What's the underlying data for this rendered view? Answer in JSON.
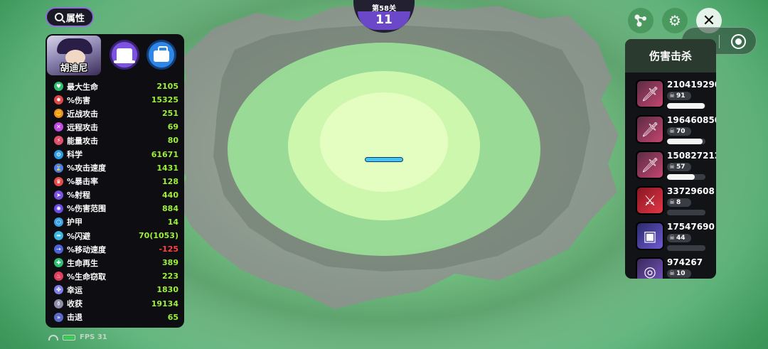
{
  "header": {
    "attr_label": "属性"
  },
  "hero": {
    "name": "胡迪尼"
  },
  "stats": [
    {
      "label": "最大生命",
      "value": "2105",
      "color": "#2fbf71"
    },
    {
      "label": "%伤害",
      "value": "15325",
      "color": "#e04848"
    },
    {
      "label": "近战攻击",
      "value": "251",
      "color": "#f08a2a"
    },
    {
      "label": "远程攻击",
      "value": "69",
      "color": "#c04be0"
    },
    {
      "label": "能量攻击",
      "value": "80",
      "color": "#e0506c"
    },
    {
      "label": "科学",
      "value": "61671",
      "color": "#2a9be6"
    },
    {
      "label": "%攻击速度",
      "value": "1431",
      "color": "#4a7ee8"
    },
    {
      "label": "%暴击率",
      "value": "128",
      "color": "#e84a4a"
    },
    {
      "label": "%射程",
      "value": "440",
      "color": "#7a52e0"
    },
    {
      "label": "%伤害范围",
      "value": "884",
      "color": "#6a4ae0"
    },
    {
      "label": "护甲",
      "value": "14",
      "color": "#3aa0e6"
    },
    {
      "label": "%闪避",
      "value": "70(1053)",
      "color": "#3ab6e0"
    },
    {
      "label": "%移动速度",
      "value": "-125",
      "color": "#4e63d8",
      "negative": true
    },
    {
      "label": "生命再生",
      "value": "389",
      "color": "#2fbf71"
    },
    {
      "label": "%生命窃取",
      "value": "223",
      "color": "#e03e5e"
    },
    {
      "label": "幸运",
      "value": "1830",
      "color": "#7e7ee6"
    },
    {
      "label": "收获",
      "value": "19134",
      "color": "#8e8ea8"
    },
    {
      "label": "击退",
      "value": "65",
      "color": "#5a6ac8"
    }
  ],
  "status_bar": {
    "fps_label": "FPS 31",
    "battery_level": 1.0
  },
  "level": {
    "stage": "第58关",
    "wave": "11"
  },
  "player": {
    "hp_fraction": 1.0
  },
  "top_buttons": {
    "skill_icon": "molecule-icon",
    "gear_icon": "gear-icon",
    "close_icon": "close-icon"
  },
  "damage_panel": {
    "title": "伤害击杀",
    "rows": [
      {
        "damage": "210419290…",
        "kills": "91",
        "bar": 0.98,
        "icon": "green-blade",
        "tint": "green"
      },
      {
        "damage": "196460850…",
        "kills": "70",
        "bar": 0.93,
        "icon": "green-blade",
        "tint": "green"
      },
      {
        "damage": "150827212…",
        "kills": "57",
        "bar": 0.72,
        "icon": "green-blade",
        "tint": "green"
      },
      {
        "damage": "33729608",
        "kills": "8",
        "bar": 0.0,
        "icon": "red-blade",
        "tint": "red"
      },
      {
        "damage": "17547690",
        "kills": "44",
        "bar": 0.0,
        "icon": "box-icon",
        "tint": "purple"
      },
      {
        "damage": "974267",
        "kills": "10",
        "bar": 0.0,
        "icon": "coin-pile",
        "tint": "gold"
      }
    ]
  }
}
